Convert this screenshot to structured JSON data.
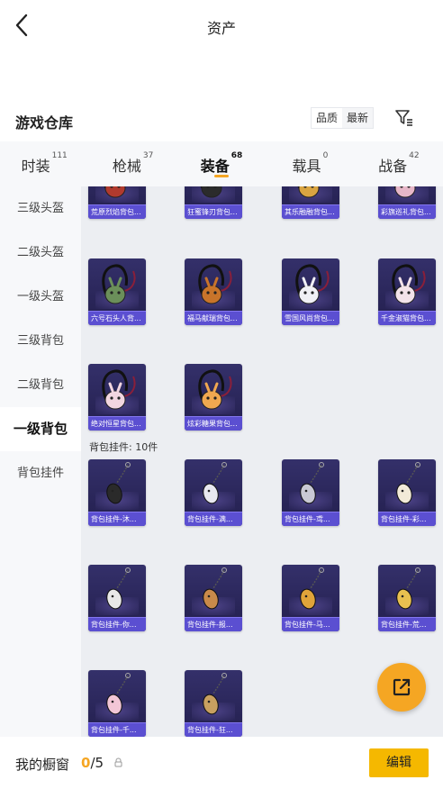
{
  "header": {
    "title": "资产",
    "back_icon": "chevron-left-icon"
  },
  "warehouse": {
    "title": "游戏仓库",
    "sort_options": [
      "品质",
      "最新"
    ],
    "filter_icon": "filter-icon"
  },
  "tabs": [
    {
      "label": "时装",
      "count": "111",
      "active": false
    },
    {
      "label": "枪械",
      "count": "37",
      "active": false
    },
    {
      "label": "装备",
      "count": "68",
      "active": true
    },
    {
      "label": "载具",
      "count": "0",
      "active": false
    },
    {
      "label": "战备",
      "count": "42",
      "active": false
    }
  ],
  "sidebar": [
    {
      "label": "三级头盔",
      "active": false
    },
    {
      "label": "二级头盔",
      "active": false
    },
    {
      "label": "一级头盔",
      "active": false
    },
    {
      "label": "三级背包",
      "active": false
    },
    {
      "label": "二级背包",
      "active": false
    },
    {
      "label": "一级背包",
      "active": true
    },
    {
      "label": "背包挂件",
      "active": false
    }
  ],
  "backpacks": [
    {
      "name": "荒原烈焰背包...",
      "icon": "backpack-icon",
      "accent": "#b03a2e"
    },
    {
      "name": "狂蜜锋刃背包...",
      "icon": "backpack-icon",
      "accent": "#2b2b2b"
    },
    {
      "name": "其乐融融背包...",
      "icon": "backpack-icon",
      "accent": "#d9a441"
    },
    {
      "name": "彩旗巡礼背包...",
      "icon": "backpack-icon",
      "accent": "#e7b7c8"
    },
    {
      "name": "六号石头人背...",
      "icon": "backpack-icon",
      "accent": "#6b8f5a"
    },
    {
      "name": "福马献瑞背包...",
      "icon": "backpack-icon",
      "accent": "#c8742a"
    },
    {
      "name": "雪国风尚背包...",
      "icon": "backpack-icon",
      "accent": "#f0f0f5"
    },
    {
      "name": "千金淑猫背包...",
      "icon": "backpack-icon",
      "accent": "#f3e3ea"
    },
    {
      "name": "绝对恒星背包...",
      "icon": "backpack-icon",
      "accent": "#f2d6e0"
    },
    {
      "name": "炫彩糖果背包...",
      "icon": "backpack-icon",
      "accent": "#f0a850"
    }
  ],
  "pendant_section": {
    "label": "背包挂件: 10件"
  },
  "pendants": [
    {
      "name": "背包挂件-沐...",
      "icon": "pendant-icon",
      "accent": "#2a2a2a"
    },
    {
      "name": "背包挂件-满...",
      "icon": "pendant-icon",
      "accent": "#e8e8f0"
    },
    {
      "name": "背包挂件-鸢...",
      "icon": "pendant-icon",
      "accent": "#c9c9d4"
    },
    {
      "name": "背包挂件-彩...",
      "icon": "pendant-icon",
      "accent": "#f2ead8"
    },
    {
      "name": "背包挂件-你...",
      "icon": "pendant-icon",
      "accent": "#e8e8e8"
    },
    {
      "name": "背包挂件-报...",
      "icon": "pendant-icon",
      "accent": "#c98a4a"
    },
    {
      "name": "背包挂件-马...",
      "icon": "pendant-icon",
      "accent": "#e0a43a"
    },
    {
      "name": "背包挂件-荒...",
      "icon": "pendant-icon",
      "accent": "#e8c050"
    },
    {
      "name": "背包挂件-千...",
      "icon": "pendant-icon",
      "accent": "#f2c6d6"
    },
    {
      "name": "背包挂件-狂...",
      "icon": "pendant-icon",
      "accent": "#c8a060"
    }
  ],
  "share_button": {
    "icon": "share-icon"
  },
  "bottom": {
    "closet_label": "我的橱窗",
    "closet_used": "0",
    "closet_total": "/5",
    "lock_icon": "lock-icon",
    "edit_label": "编辑"
  },
  "colors": {
    "accent": "#f5a623",
    "card_bg": "#2a2658",
    "card_caption": "#5b4fd1",
    "edit_button": "#f5b800"
  }
}
